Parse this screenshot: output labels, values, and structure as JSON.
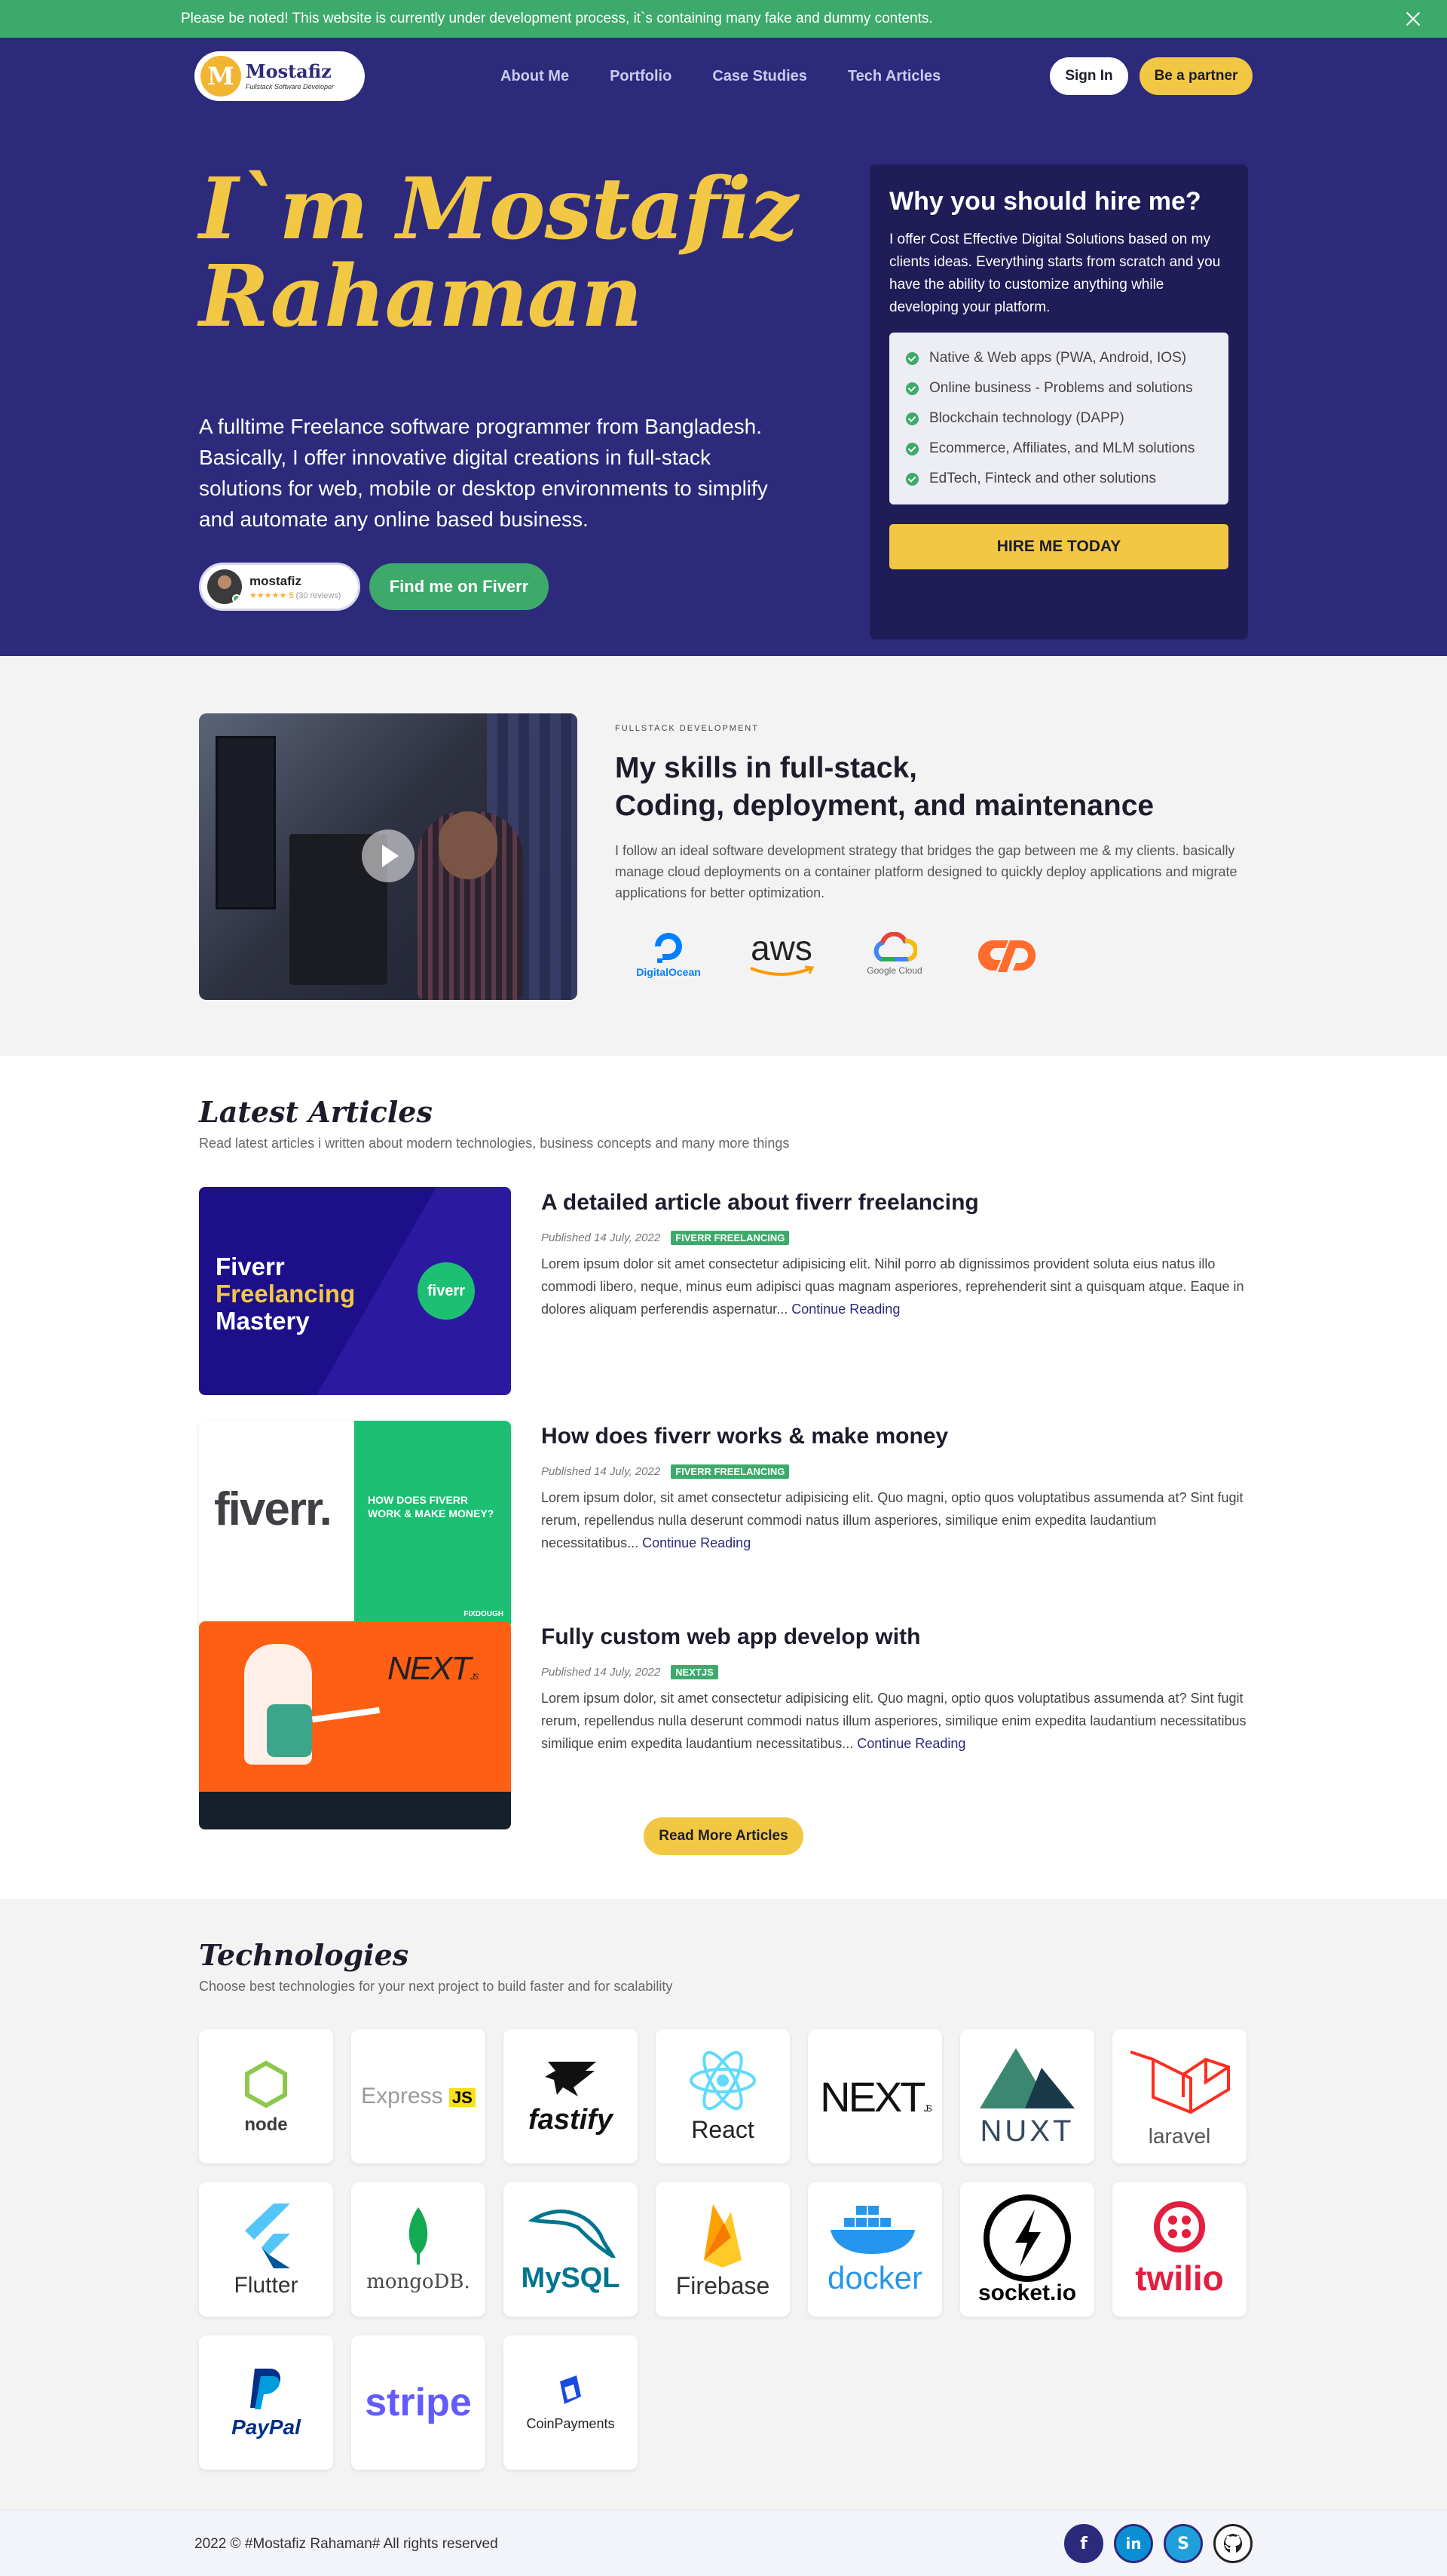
{
  "notice": {
    "text": "Please be noted! This website is currently under development process, it`s containing many fake and dummy contents."
  },
  "nav": {
    "logo_letter": "M",
    "logo_name": "Mostafiz",
    "logo_tagline": "Fullstack Software Developer",
    "menu": [
      "About Me",
      "Portfolio",
      "Case Studies",
      "Tech Articles"
    ],
    "sign_in": "Sign In",
    "partner": "Be a partner"
  },
  "hero": {
    "title_line1": "I`m Mostafiz",
    "title_line2": "Rahaman",
    "description": "A fulltime Freelance software programmer from Bangladesh. Basically, I offer innovative digital creations in full-stack solutions for web, mobile or desktop environments to simplify and automate any online based business.",
    "fiverr_name": "mostafiz",
    "fiverr_stars": "★★★★★ 5",
    "fiverr_reviews": "(30 reviews)",
    "fiverr_button": "Find me on Fiverr"
  },
  "hire": {
    "title": "Why you should hire me?",
    "text": "I offer Cost Effective Digital Solutions based on my clients ideas. Everything starts from scratch and you have the ability to customize anything while developing your platform.",
    "items": [
      "Native & Web apps (PWA, Android, IOS)",
      "Online business - Problems and solutions",
      "Blockchain technology (DAPP)",
      "Ecommerce, Affiliates, and MLM solutions",
      "EdTech, Finteck and other solutions"
    ],
    "button": "HIRE ME TODAY"
  },
  "skills": {
    "eyebrow": "FULLSTACK DEVELOPMENT",
    "title_line1": "My skills in full-stack,",
    "title_line2": "Coding, deployment, and maintenance",
    "description": "I follow an ideal software development strategy that bridges the gap between me & my clients. basically manage cloud deployments on a container platform designed to quickly deploy applications and migrate applications for better optimization.",
    "logos": [
      "DigitalOcean",
      "aws",
      "Google Cloud",
      "cPanel"
    ]
  },
  "articles": {
    "title": "Latest Articles",
    "subtitle": "Read latest articles i written about modern technologies, business concepts and many more things",
    "items": [
      {
        "title": "A detailed article about fiverr freelancing",
        "date": "Published 14 July, 2022",
        "tag": "FIVERR FREELANCING",
        "text": "Lorem ipsum dolor sit amet consectetur adipisicing elit. Nihil porro ab dignissimos provident soluta eius natus illo commodi libero, neque, minus eum adipisci quas magnam asperiores, reprehenderit sint a quisquam atque. Eaque in dolores aliquam perferendis aspernatur...",
        "img_l1": "Fiverr",
        "img_l2": "Freelancing",
        "img_l3": "Mastery",
        "img_badge": "fiverr"
      },
      {
        "title": "How does fiverr works & make money",
        "date": "Published 14 July, 2022",
        "tag": "FIVERR FREELANCING",
        "text": "Lorem ipsum dolor, sit amet consectetur adipisicing elit. Quo magni, optio quos voluptatibus assumenda at? Sint fugit rerum, repellendus nulla deserunt commodi natus illum asperiores, similique enim expedita laudantium necessitatibus...",
        "img_logo": "fiverr.",
        "img_caption": "HOW DOES FIVERR WORK & MAKE MONEY?",
        "img_brand": "FIXDOUGH"
      },
      {
        "title": "Fully custom web app develop with",
        "date": "Published 14 July, 2022",
        "tag": "NEXTJS",
        "text": "Lorem ipsum dolor, sit amet consectetur adipisicing elit. Quo magni, optio quos voluptatibus assumenda at? Sint fugit rerum, repellendus nulla deserunt commodi natus illum asperiores, similique enim expedita laudantium necessitatibus similique enim expedita laudantium necessitatibus...",
        "img_logo": "NEXT",
        "img_logo_suffix": ".JS"
      }
    ],
    "continue": "Continue Reading",
    "more_button": "Read More Articles"
  },
  "technologies": {
    "title": "Technologies",
    "subtitle": "Choose best technologies for your next project to build faster and for scalability",
    "items": [
      "node",
      "Express",
      "fastify",
      "React",
      "NEXT",
      "NUXT",
      "laravel",
      "Flutter",
      "mongoDB.",
      "MySQL",
      "Firebase",
      "docker",
      "socket.io",
      "twilio",
      "PayPal",
      "stripe",
      "CoinPayments"
    ]
  },
  "footer": {
    "copyright": "2022 © #Mostafiz Rahaman# All rights reserved",
    "socials": [
      "facebook-icon",
      "linkedin-icon",
      "skype-icon",
      "github-icon"
    ]
  },
  "colors": {
    "primary": "#2d2a7c",
    "accent": "#f2c744",
    "success": "#3daa6b"
  }
}
